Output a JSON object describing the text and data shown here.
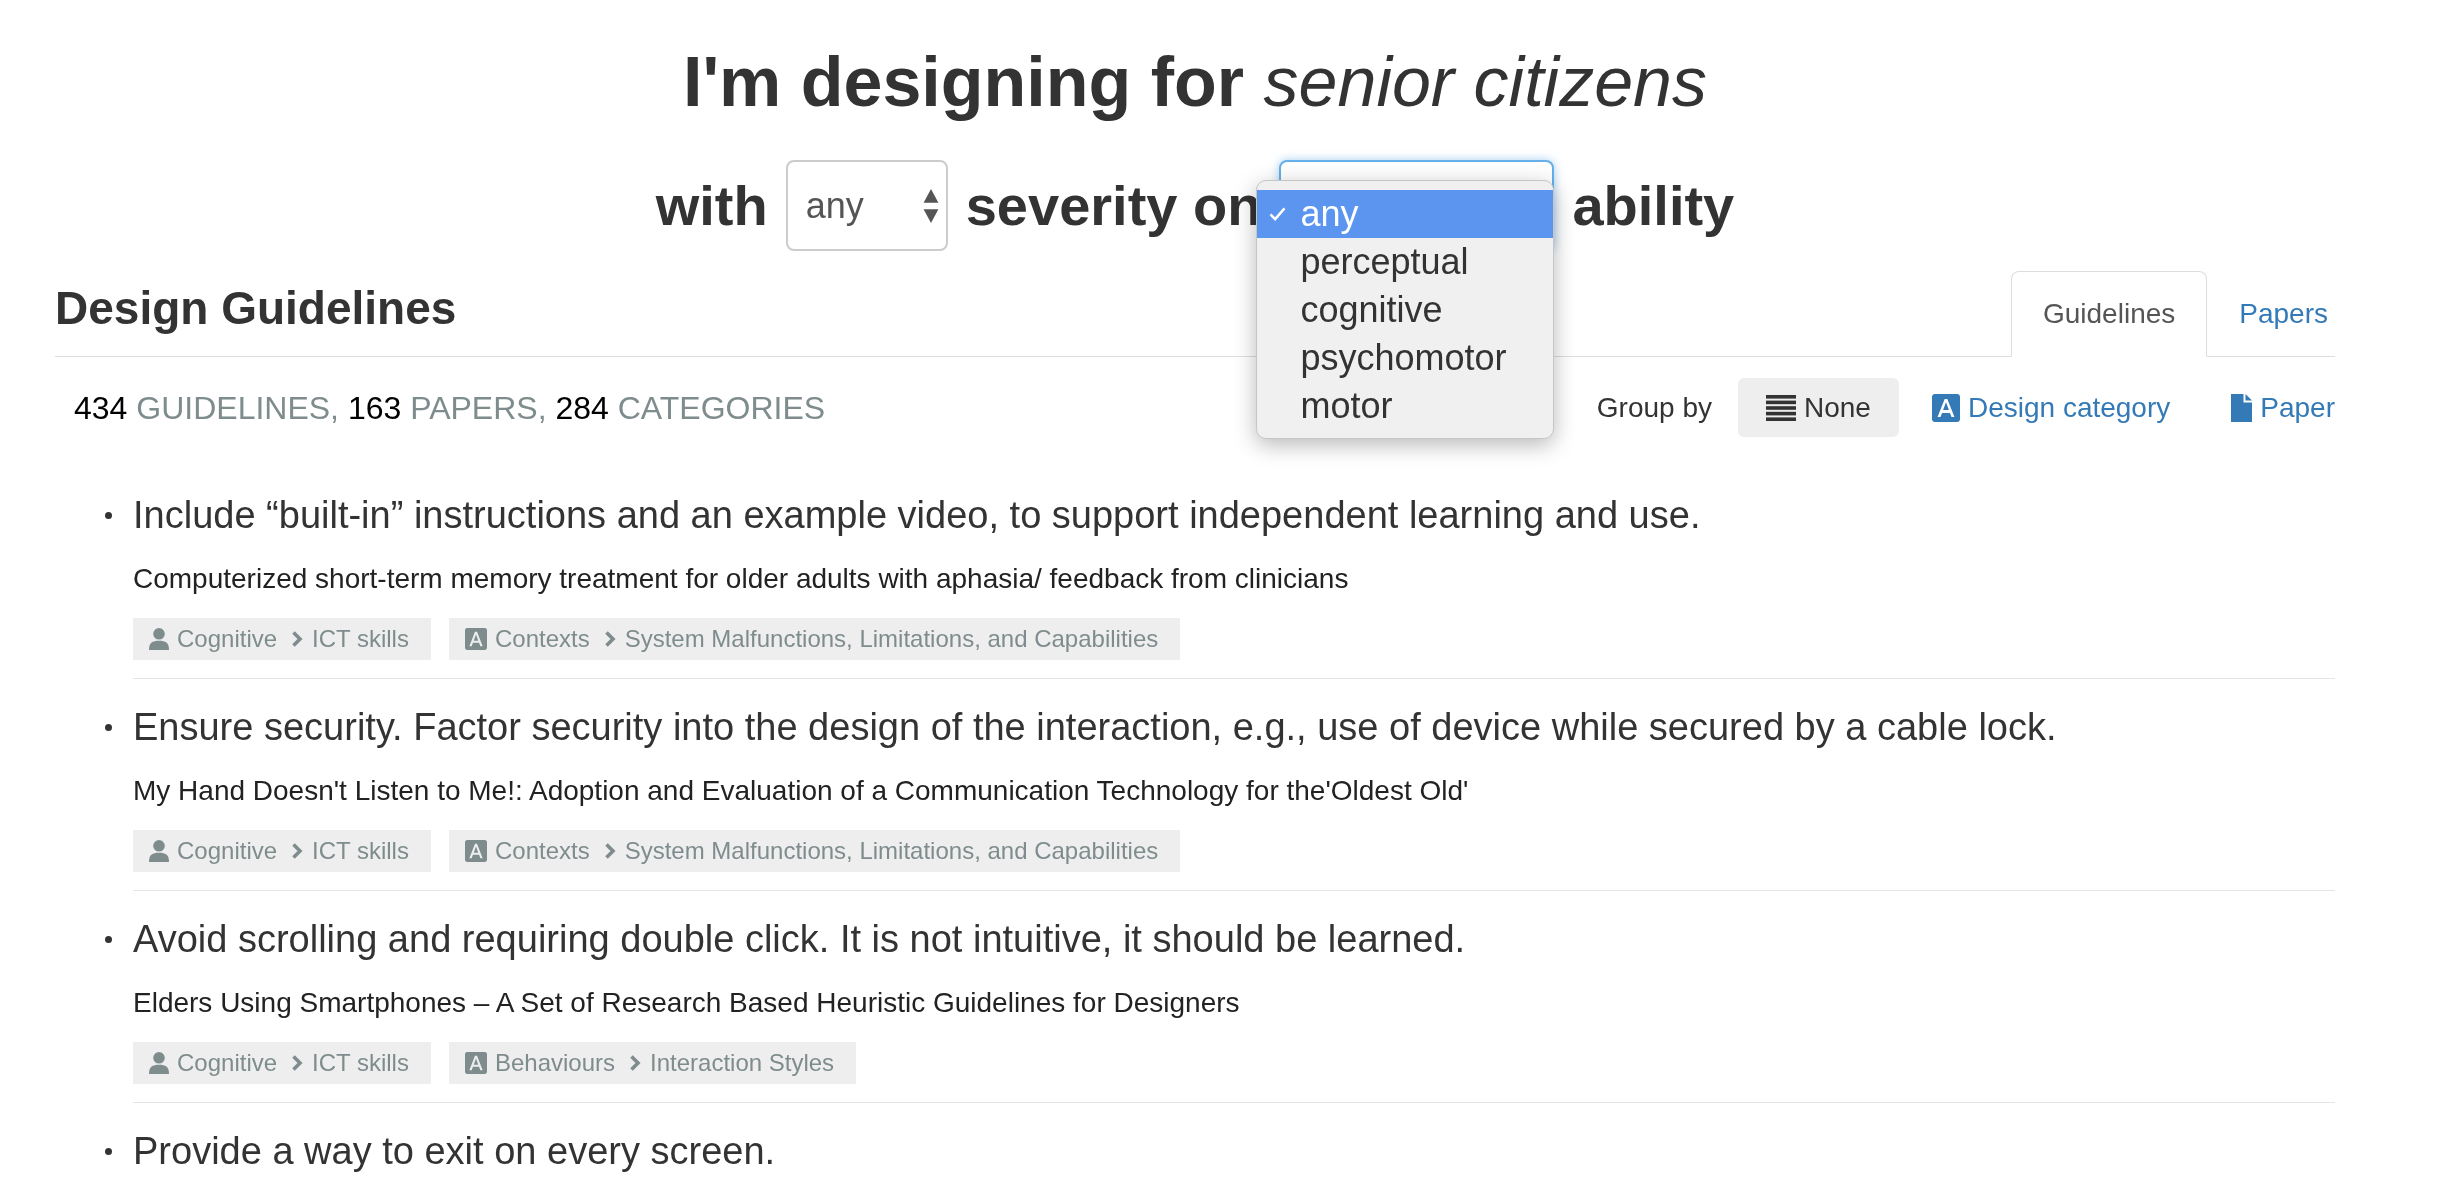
{
  "header": {
    "title": "I'm designing for *senior citizens*",
    "filter_prefix": "with",
    "severity_select": {
      "value": "any"
    },
    "filter_middle": "severity on",
    "ability_select": {
      "focused": true,
      "expanded": true,
      "options": [
        {
          "label": "any",
          "selected": true
        },
        {
          "label": "perceptual",
          "selected": false
        },
        {
          "label": "cognitive",
          "selected": false
        },
        {
          "label": "psychomotor",
          "selected": false
        },
        {
          "label": "motor",
          "selected": false
        }
      ]
    },
    "filter_suffix": "ability"
  },
  "section": {
    "title": "Design Guidelines",
    "tabs": [
      {
        "label": "Guidelines",
        "selected": true
      },
      {
        "label": "Papers",
        "selected": false
      }
    ]
  },
  "summary": [
    {
      "count": "434",
      "label": "GUIDELINES,"
    },
    {
      "count": "163",
      "label": "PAPERS,"
    },
    {
      "count": "284",
      "label": "CATEGORIES"
    }
  ],
  "group_by": {
    "label": "Group by",
    "options": [
      {
        "label": "None",
        "selected": true
      },
      {
        "label": "Design category",
        "selected": false
      },
      {
        "label": "Paper",
        "selected": false
      }
    ]
  },
  "guidelines": [
    {
      "text": "Include “built-in” instructions and an example video, to support independent learning and use.",
      "paper": "Computerized short-term memory treatment for older adults with aphasia/ feedback from clinicians",
      "tags": [
        {
          "kind": "user",
          "category": "Cognitive",
          "subcategory": "ICT skills"
        },
        {
          "kind": "design",
          "category": "Contexts",
          "subcategory": "System Malfunctions, Limitations, and Capabilities"
        }
      ]
    },
    {
      "text": "Ensure security. Factor security into the design of the interaction, e.g., use of device while secured by a cable lock.",
      "paper": "My Hand Doesn't Listen to Me!: Adoption and Evaluation of a Communication Technology for the'Oldest Old'",
      "tags": [
        {
          "kind": "user",
          "category": "Cognitive",
          "subcategory": "ICT skills"
        },
        {
          "kind": "design",
          "category": "Contexts",
          "subcategory": "System Malfunctions, Limitations, and Capabilities"
        }
      ]
    },
    {
      "text": "Avoid scrolling and requiring double click. It is not intuitive, it should be learned.",
      "paper": "Elders Using Smartphones – A Set of Research Based Heuristic Guidelines for Designers",
      "tags": [
        {
          "kind": "user",
          "category": "Cognitive",
          "subcategory": "ICT skills"
        },
        {
          "kind": "design",
          "category": "Behaviours",
          "subcategory": "Interaction Styles"
        }
      ]
    },
    {
      "text": "Provide a way to exit on every screen."
    }
  ]
}
